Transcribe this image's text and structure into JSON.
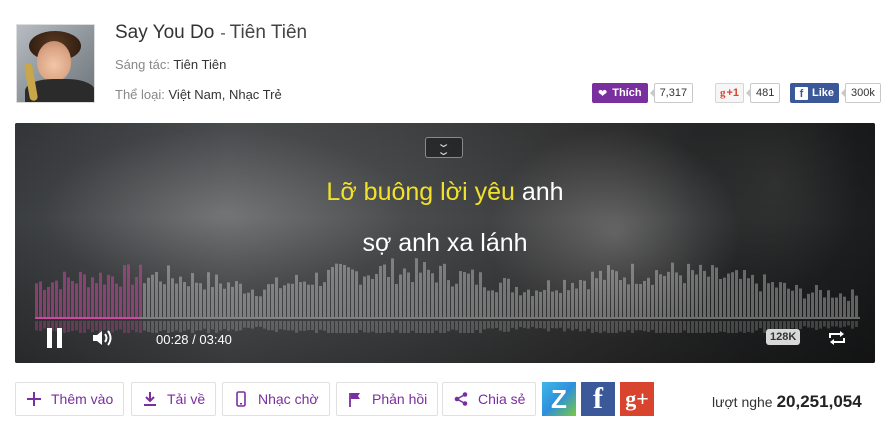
{
  "song": {
    "title": "Say You Do",
    "separator": "-",
    "artist": "Tiên Tiên",
    "composer_label": "Sáng tác:",
    "composer": "Tiên Tiên",
    "genre_label": "Thể loại:",
    "genres": "Việt Nam, Nhạc Trẻ"
  },
  "social": {
    "like_label": "Thích",
    "like_count": "7,317",
    "gplus_label": "+1",
    "gplus_count": "481",
    "fb_label": "Like",
    "fb_count": "300k"
  },
  "player": {
    "lyric_line1_highlight": "Lỡ buông lời yêu",
    "lyric_line1_rest": " anh",
    "lyric_line2": "sợ anh xa lánh",
    "time": "00:28 / 03:40",
    "quality": "128K",
    "progress": 0.127,
    "accent_color": "#c84a9c",
    "lyric_highlight_color": "#f2e12a"
  },
  "actions": {
    "add_label": "Thêm vào",
    "download_label": "Tải về",
    "ringtone_label": "Nhạc chờ",
    "feedback_label": "Phản hồi",
    "share_label": "Chia sẻ"
  },
  "share_icons": {
    "zalo": "Z",
    "facebook": "f",
    "gplus": "g+"
  },
  "stats": {
    "listens_label": "lượt nghe",
    "listens": "20,251,054"
  },
  "brand_color": "#7a2f9f"
}
